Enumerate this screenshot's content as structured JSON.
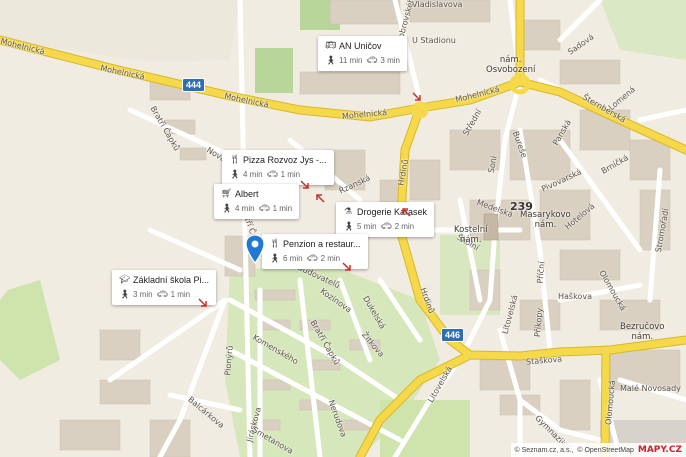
{
  "streets": {
    "mohelnicka_1": "Mohelnická",
    "mohelnicka_2": "Mohelnická",
    "mohelnicka_3": "Mohelnická",
    "mohelnicka_4": "Mohelnická",
    "u_stadionu": "U Stadionu",
    "vladislavova": "Vladislavova",
    "dobrovskeho": "Dobrovského",
    "sadova": "Sadová",
    "lomena": "Lomená",
    "stemberska": "Šternberská",
    "stredni": "Střední",
    "soni": "Soni",
    "bureska": "Bureše",
    "panska": "Panská",
    "pivovarska": "Pivovarská",
    "brnicka": "Brníčká",
    "hotelova": "Hotelová",
    "stromoradi": "Stromořadí",
    "medelska": "Medelská",
    "skolni": "Školní",
    "hrdinu": "Hrdinů",
    "hrdinu_2": "Hrdinů",
    "budovatelu": "Budovatelů",
    "kozinova": "Kozinova",
    "dukelska": "Dukelská",
    "zitkova": "Žitkova",
    "bratri_capku": "Bratří Čapků",
    "bratri_capku_2": "Bratří Čapků",
    "komenskeho": "Komenského",
    "pionyru": "Pionýrů",
    "balcarkova": "Balcárkova",
    "jiraskova": "Jiráskova",
    "smetanova": "Smetanova",
    "nerudova": "Nerudova",
    "litovelska": "Litovelská",
    "litovelska_2": "Litovelská",
    "stazkova": "Staškova",
    "haskova": "Haškova",
    "prikopy": "Příkopy",
    "pricni": "Příční",
    "oborenska": "Olomoucká",
    "olomoucka": "Olomoucká",
    "gymnazijni": "Gymnazijní",
    "male_novosady": "Malé Novosady",
    "rzanska": "Řzanská",
    "bratri_capku_3": "Bratří Čapků",
    "nova": "Nová"
  },
  "squares": {
    "osvobozeni": "nám.\nOsvobození",
    "masarykovo": "Masarykovo\nnám.",
    "kostelni": "Kostelní\nnám.",
    "bezrucovo": "Bezručovo\nnám."
  },
  "house_number": "239",
  "route_numbers": [
    "444",
    "446"
  ],
  "pois": [
    {
      "icon": "bus-icon",
      "name": "AN Uničov",
      "walk": "11 min",
      "drive": "3 min"
    },
    {
      "icon": "restaurant-icon",
      "name": "Pizza Rozvoz Jys -...",
      "walk": "4 min",
      "drive": "1 min"
    },
    {
      "icon": "shopping-cart-icon",
      "name": "Albert",
      "walk": "4 min",
      "drive": "1 min"
    },
    {
      "icon": "drugstore-icon",
      "name": "Drogerie Karasek",
      "walk": "5 min",
      "drive": "2 min"
    },
    {
      "icon": "restaurant-icon",
      "name": "Penzion a restaur...",
      "walk": "6 min",
      "drive": "2 min"
    },
    {
      "icon": "school-icon",
      "name": "Základní škola Pi...",
      "walk": "3 min",
      "drive": "1 min"
    }
  ],
  "attribution": {
    "seznam": "© Seznam.cz, a.s.,",
    "osm": "© OpenStreetMap",
    "logo": "MAPY.CZ"
  },
  "colors": {
    "land": "#f1ece2",
    "park": "#c8dfa4",
    "building": "#d9d0c2",
    "major_road": "#f5d94a",
    "minor_road": "#ffffff",
    "marker": "#1f79d4"
  }
}
